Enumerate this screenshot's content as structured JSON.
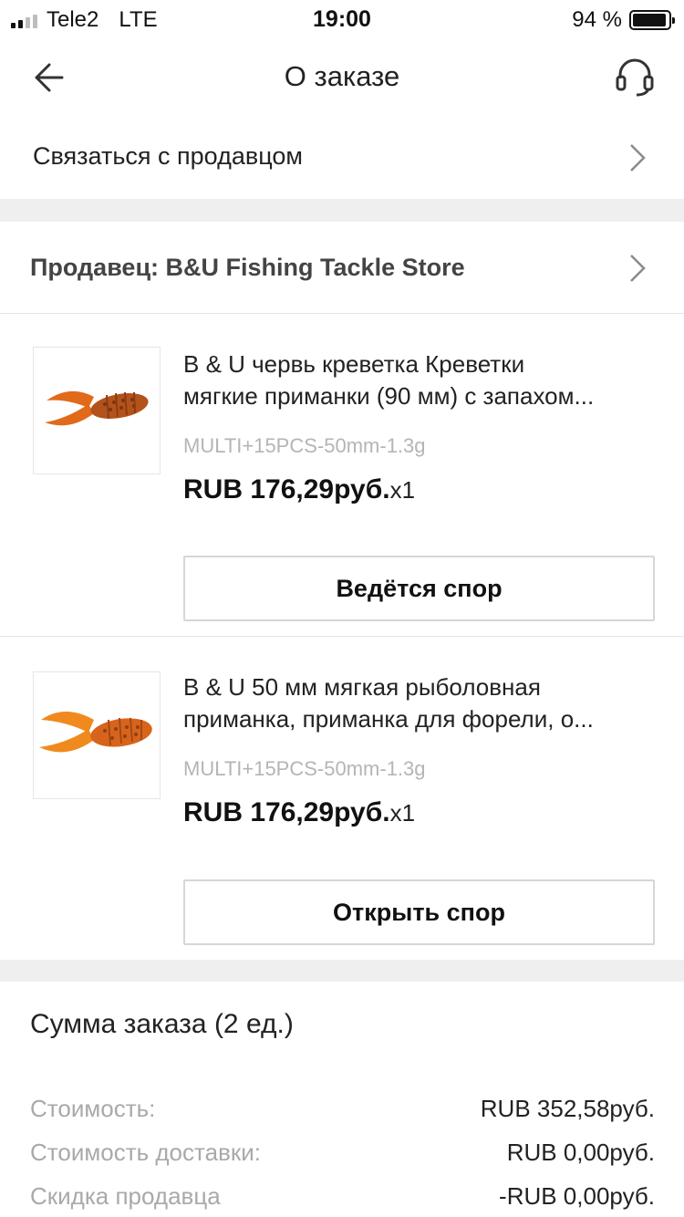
{
  "status_bar": {
    "carrier": "Tele2",
    "network": "LTE",
    "time": "19:00",
    "battery": "94 %",
    "battery_level": 0.94,
    "signal_bars": 2
  },
  "header": {
    "title": "О заказе",
    "back_icon": "back-arrow-icon",
    "support_icon": "headset-icon"
  },
  "contact_seller": {
    "label": "Связаться с продавцом"
  },
  "seller": {
    "label": "Продавец: B&U Fishing Tackle Store"
  },
  "items": [
    {
      "title_line1": "B & U червь креветка Креветки",
      "title_line2": "мягкие приманки (90 мм) с запахом...",
      "sku": "MULTI+15PCS-50mm-1.3g",
      "price": "RUB 176,29руб.",
      "qty": "x1",
      "button": "Ведётся спор"
    },
    {
      "title_line1": "B & U 50 мм мягкая рыболовная",
      "title_line2": "приманка, приманка для форели, о...",
      "sku": "MULTI+15PCS-50mm-1.3g",
      "price": "RUB 176,29руб.",
      "qty": "x1",
      "button": "Открыть спор"
    }
  ],
  "summary": {
    "title": "Сумма заказа (2 ед.)",
    "rows": [
      {
        "label": "Стоимость:",
        "value": "RUB 352,58руб."
      },
      {
        "label": "Стоимость доставки:",
        "value": "RUB 0,00руб."
      },
      {
        "label": "Скидка продавца",
        "value": "-RUB 0,00руб."
      }
    ]
  },
  "colors": {
    "lure_dark": "#b8501a",
    "lure_light": "#e8801e",
    "band": "#efefef"
  }
}
